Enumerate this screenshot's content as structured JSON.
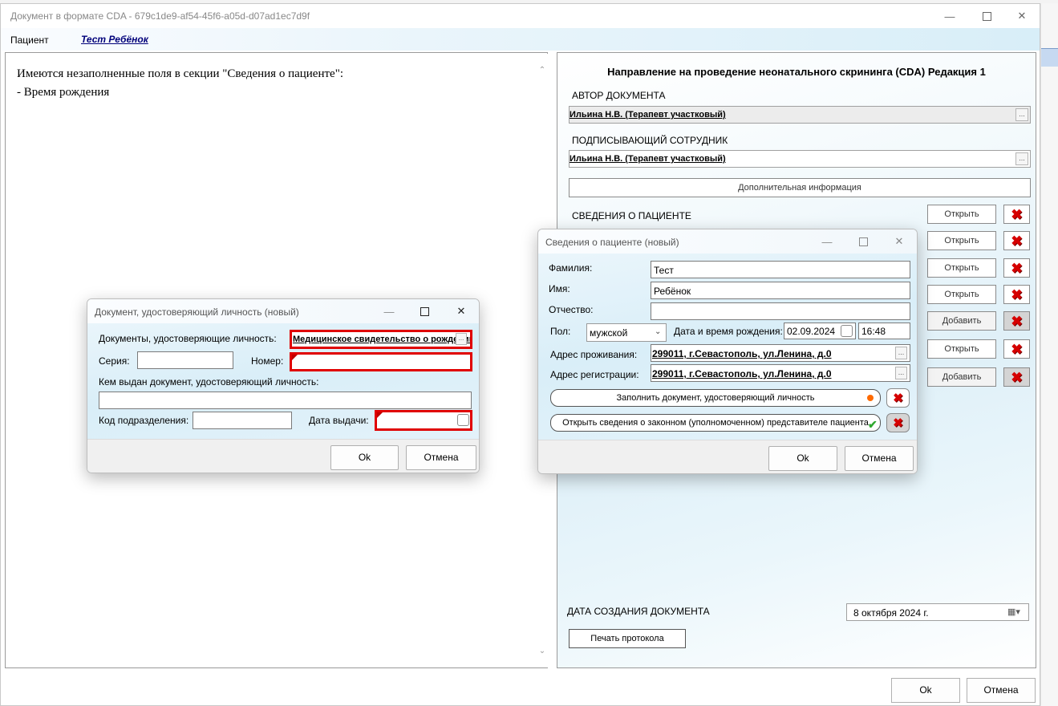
{
  "main_window": {
    "title": "Документ в формате CDA - 679c1de9-af54-45f6-a05d-d07ad1ec7d9f",
    "patient_label": "Пациент",
    "patient_name": "Тест Ребёнок",
    "ok_label": "Ok",
    "cancel_label": "Отмена"
  },
  "message_panel": {
    "lines": [
      "Имеются незаполненные поля в секции \"Сведения о пациенте\":",
      "- Время рождения"
    ]
  },
  "document_panel": {
    "title": "Направление на проведение неонатального скрининга (CDA) Редакция 1",
    "author_section": "АВТОР ДОКУМЕНТА",
    "author_value": "Ильина Н.В. (Терапевт участковый)",
    "signer_section": "ПОДПИСЫВАЮЩИЙ СОТРУДНИК",
    "signer_value": "Ильина Н.В. (Терапевт участковый)",
    "additional_info_button": "Дополнительная информация",
    "patient_section": "СВЕДЕНИЯ О ПАЦИЕНТЕ",
    "rows": [
      {
        "button": "Открыть"
      },
      {
        "button": "Открыть"
      },
      {
        "button": "Открыть"
      },
      {
        "button": "Открыть"
      },
      {
        "button": "Добавить"
      },
      {
        "button": "Открыть"
      },
      {
        "button": "Добавить"
      }
    ],
    "date_section": "ДАТА СОЗДАНИЯ ДОКУМЕНТА",
    "date_value": "8  октября  2024 г.",
    "print_button": "Печать протокола"
  },
  "patient_dialog": {
    "title": "Сведения о пациенте (новый)",
    "surname_label": "Фамилия:",
    "surname_value": "Тест",
    "name_label": "Имя:",
    "name_value": "Ребёнок",
    "patronymic_label": "Отчество:",
    "patronymic_value": "",
    "sex_label": "Пол:",
    "sex_value": "мужской",
    "birth_label": "Дата и время рождения:",
    "birth_date": "02.09.2024",
    "birth_time": "16:48",
    "residence_label": "Адрес проживания:",
    "residence_value": "299011, г.Севастополь, ул.Ленина, д.0",
    "registration_label": "Адрес регистрации:",
    "registration_value": "299011, г.Севастополь, ул.Ленина, д.0",
    "fill_identity_button": "Заполнить документ, удостоверяющий личность",
    "open_representative_button": "Открыть сведения о законном (уполномоченном) представителе пациента",
    "ok_label": "Ok",
    "cancel_label": "Отмена"
  },
  "identity_dialog": {
    "title": "Документ, удостоверяющий личность (новый)",
    "doc_type_label": "Документы, удостоверяющие личность:",
    "doc_type_value": "Медицинское свидетельство о рождении",
    "series_label": "Серия:",
    "number_label": "Номер:",
    "issued_by_label": "Кем выдан документ, удостоверяющий личность:",
    "division_code_label": "Код подразделения:",
    "issue_date_label": "Дата выдачи:",
    "ok_label": "Ok",
    "cancel_label": "Отмена"
  },
  "colors": {
    "required_border": "#e00000",
    "link": "#00007a",
    "delete_icon": "#d60000",
    "status_dot_orange": "#ff6a00",
    "status_check_green": "#2fa82f"
  }
}
